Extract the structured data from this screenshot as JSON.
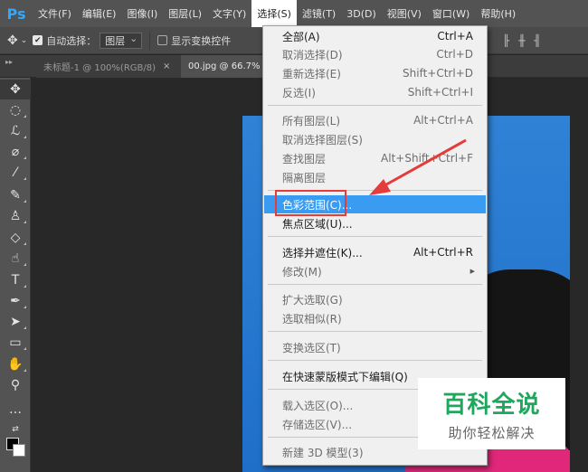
{
  "app": {
    "logo": "Ps",
    "brand_color": "#31a8ff"
  },
  "menubar": {
    "items": [
      "文件(F)",
      "编辑(E)",
      "图像(I)",
      "图层(L)",
      "文字(Y)",
      "选择(S)",
      "滤镜(T)",
      "3D(D)",
      "视图(V)",
      "窗口(W)",
      "帮助(H)"
    ],
    "active": "选择(S)"
  },
  "options": {
    "auto_select_label": "自动选择：",
    "auto_select_checked": true,
    "auto_select_value": "图层",
    "show_transform_label": "显示变换控件",
    "show_transform_checked": false
  },
  "tabs": [
    {
      "label": "未标题-1 @ 100%(RGB/8)",
      "close": "×"
    },
    {
      "label": "00.jpg @ 66.7%"
    }
  ],
  "toolbar": {
    "tools": [
      "move-icon",
      "marquee-icon",
      "lasso-icon",
      "quick-select-icon",
      "eyedropper-icon",
      "brush-icon",
      "stamp-icon",
      "eraser-icon",
      "smudge-icon",
      "type-icon",
      "pen-icon",
      "path-select-icon",
      "rectangle-icon",
      "hand-icon",
      "zoom-icon",
      "more-icon"
    ]
  },
  "select_menu": {
    "highlight_color": "#3a9bf2",
    "items": [
      {
        "label": "全部(A)",
        "shortcut": "Ctrl+A",
        "enabled": true
      },
      {
        "label": "取消选择(D)",
        "shortcut": "Ctrl+D",
        "enabled": false
      },
      {
        "label": "重新选择(E)",
        "shortcut": "Shift+Ctrl+D",
        "enabled": false
      },
      {
        "label": "反选(I)",
        "shortcut": "Shift+Ctrl+I",
        "enabled": false
      },
      {
        "label": "所有图层(L)",
        "shortcut": "Alt+Ctrl+A",
        "enabled": false
      },
      {
        "label": "取消选择图层(S)",
        "shortcut": "",
        "enabled": false
      },
      {
        "label": "查找图层",
        "shortcut": "Alt+Shift+Ctrl+F",
        "enabled": false
      },
      {
        "label": "隔离图层",
        "shortcut": "",
        "enabled": false
      },
      {
        "label": "色彩范围(C)...",
        "shortcut": "",
        "enabled": true,
        "highlighted": true
      },
      {
        "label": "焦点区域(U)...",
        "shortcut": "",
        "enabled": true
      },
      {
        "label": "选择并遮住(K)...",
        "shortcut": "Alt+Ctrl+R",
        "enabled": true
      },
      {
        "label": "修改(M)",
        "shortcut": "",
        "enabled": false,
        "submenu": true
      },
      {
        "label": "扩大选取(G)",
        "shortcut": "",
        "enabled": false
      },
      {
        "label": "选取相似(R)",
        "shortcut": "",
        "enabled": false
      },
      {
        "label": "变换选区(T)",
        "shortcut": "",
        "enabled": false
      },
      {
        "label": "在快速蒙版模式下编辑(Q)",
        "shortcut": "",
        "enabled": true
      },
      {
        "label": "载入选区(O)...",
        "shortcut": "",
        "enabled": false
      },
      {
        "label": "存储选区(V)...",
        "shortcut": "",
        "enabled": false
      },
      {
        "label": "新建 3D 模型(3)",
        "shortcut": "",
        "enabled": false
      }
    ]
  },
  "annotation": {
    "color": "#e53b3b"
  },
  "watermark": {
    "title": "百科全说",
    "subtitle": "助你轻松解决",
    "title_color": "#1fa75e"
  }
}
